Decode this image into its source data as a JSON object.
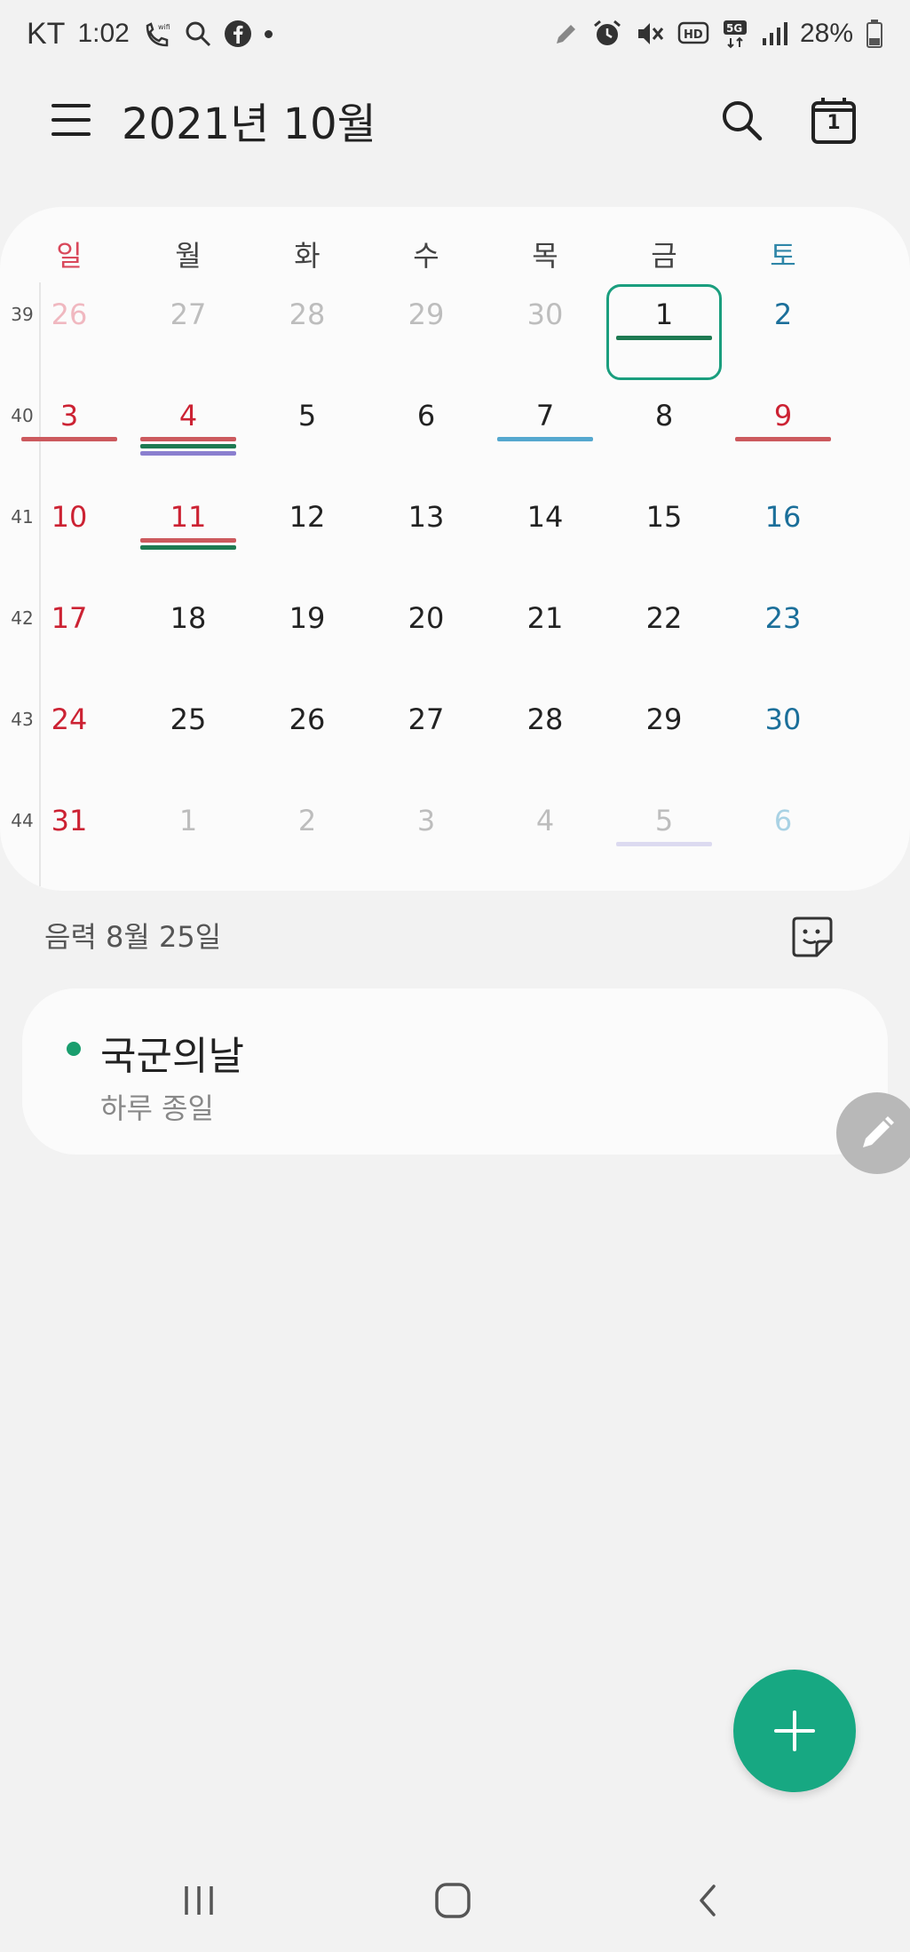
{
  "status_bar": {
    "carrier": "KT",
    "time": "1:02",
    "battery": "28%",
    "icons_left": [
      "wifi-call-icon",
      "search-icon",
      "facebook-icon",
      "dot-icon"
    ],
    "icons_right": [
      "pencil-icon",
      "alarm-icon",
      "mute-icon",
      "hd-icon",
      "5g-icon",
      "signal-icon",
      "battery-icon"
    ]
  },
  "header": {
    "title": "2021년 10월",
    "today_icon_label": "1"
  },
  "calendar": {
    "weekdays": [
      "일",
      "월",
      "화",
      "수",
      "목",
      "금",
      "토"
    ],
    "weekday_colors": [
      "#d9485b",
      "#444444",
      "#444444",
      "#444444",
      "#444444",
      "#444444",
      "#2f86a8"
    ],
    "week_numbers": [
      "39",
      "40",
      "41",
      "42",
      "43",
      "44"
    ],
    "weeks": [
      [
        {
          "d": "26",
          "c": "#f0b8c0"
        },
        {
          "d": "27",
          "c": "#bdbdbd"
        },
        {
          "d": "28",
          "c": "#bdbdbd"
        },
        {
          "d": "29",
          "c": "#bdbdbd"
        },
        {
          "d": "30",
          "c": "#bdbdbd"
        },
        {
          "d": "1",
          "c": "#222222",
          "today": true,
          "bars": [
            "#1e7a52"
          ]
        },
        {
          "d": "2",
          "c": "#1b6f9a"
        }
      ],
      [
        {
          "d": "3",
          "c": "#cc2233",
          "bars": [
            "#cc5a5e"
          ]
        },
        {
          "d": "4",
          "c": "#cc2233",
          "bars": [
            "#cc5a5e",
            "#1e7a52",
            "#8a7fcf"
          ]
        },
        {
          "d": "5",
          "c": "#222222"
        },
        {
          "d": "6",
          "c": "#222222"
        },
        {
          "d": "7",
          "c": "#222222",
          "bars": [
            "#55a8cf"
          ]
        },
        {
          "d": "8",
          "c": "#222222"
        },
        {
          "d": "9",
          "c": "#cc2233",
          "bars": [
            "#cc5a5e"
          ]
        }
      ],
      [
        {
          "d": "10",
          "c": "#cc2233"
        },
        {
          "d": "11",
          "c": "#cc2233",
          "bars": [
            "#cc5a5e",
            "#1e7a52"
          ]
        },
        {
          "d": "12",
          "c": "#222222"
        },
        {
          "d": "13",
          "c": "#222222"
        },
        {
          "d": "14",
          "c": "#222222"
        },
        {
          "d": "15",
          "c": "#222222"
        },
        {
          "d": "16",
          "c": "#1b6f9a"
        }
      ],
      [
        {
          "d": "17",
          "c": "#cc2233"
        },
        {
          "d": "18",
          "c": "#222222"
        },
        {
          "d": "19",
          "c": "#222222"
        },
        {
          "d": "20",
          "c": "#222222"
        },
        {
          "d": "21",
          "c": "#222222"
        },
        {
          "d": "22",
          "c": "#222222"
        },
        {
          "d": "23",
          "c": "#1b6f9a"
        }
      ],
      [
        {
          "d": "24",
          "c": "#cc2233"
        },
        {
          "d": "25",
          "c": "#222222"
        },
        {
          "d": "26",
          "c": "#222222"
        },
        {
          "d": "27",
          "c": "#222222"
        },
        {
          "d": "28",
          "c": "#222222"
        },
        {
          "d": "29",
          "c": "#222222"
        },
        {
          "d": "30",
          "c": "#1b6f9a"
        }
      ],
      [
        {
          "d": "31",
          "c": "#cc2233"
        },
        {
          "d": "1",
          "c": "#bdbdbd"
        },
        {
          "d": "2",
          "c": "#bdbdbd"
        },
        {
          "d": "3",
          "c": "#bdbdbd"
        },
        {
          "d": "4",
          "c": "#bdbdbd"
        },
        {
          "d": "5",
          "c": "#bdbdbd",
          "bars": [
            "#dcdaf0"
          ]
        },
        {
          "d": "6",
          "c": "#a9d2e4"
        }
      ]
    ]
  },
  "lunar_date": "음력 8월 25일",
  "event": {
    "title": "국군의날",
    "subtitle": "하루 종일",
    "color": "#1a9e6e"
  },
  "colors": {
    "accent": "#17a882",
    "today_border": "#1a9e7e"
  }
}
